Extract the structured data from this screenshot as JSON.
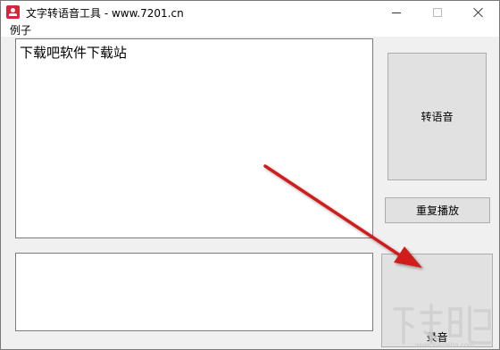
{
  "window": {
    "title": "文字转语音工具 - www.7201.cn",
    "icon": "app-icon"
  },
  "menu": {
    "items": [
      "例子"
    ]
  },
  "input_text": "下载吧软件下载站",
  "buttons": {
    "convert": "转语音",
    "replay": "重复播放",
    "record": "录音"
  },
  "annotation": {
    "color": "#d11f1f"
  },
  "watermark_text": "下载吧"
}
